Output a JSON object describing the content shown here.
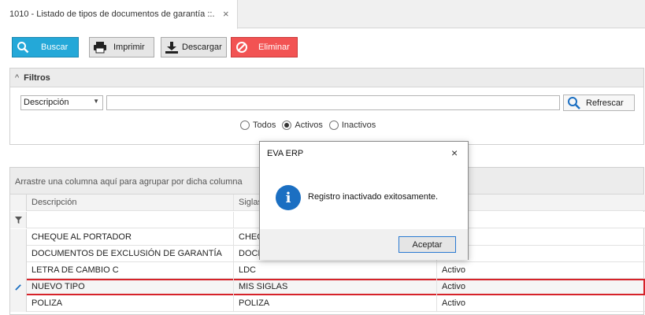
{
  "tab": {
    "title": "1010 - Listado de tipos de documentos de garantía ::.",
    "close": "×"
  },
  "toolbar": {
    "buscar": "Buscar",
    "imprimir": "Imprimir",
    "descargar": "Descargar",
    "eliminar": "Eliminar"
  },
  "filters": {
    "header": "Filtros",
    "field_select": "Descripción",
    "search_value": "",
    "refresh": "Refrescar",
    "radio_options": [
      "Todos",
      "Activos",
      "Inactivos"
    ],
    "radio_selected": "Activos"
  },
  "grid": {
    "group_hint": "Arrastre una columna aquí para agrupar por dicha columna",
    "columns": [
      "Descripción",
      "Siglas",
      ""
    ],
    "rows": [
      {
        "descripcion": "CHEQUE AL PORTADOR",
        "siglas": "CHEQ",
        "estado": ""
      },
      {
        "descripcion": "DOCUMENTOS DE EXCLUSIÓN DE GARANTÍA",
        "siglas": "DOCE",
        "estado": ""
      },
      {
        "descripcion": "LETRA DE CAMBIO C",
        "siglas": "LDC",
        "estado": "Activo"
      },
      {
        "descripcion": "NUEVO TIPO",
        "siglas": "MIS SIGLAS",
        "estado": "Activo"
      },
      {
        "descripcion": "POLIZA",
        "siglas": "POLIZA",
        "estado": "Activo"
      }
    ]
  },
  "dialog": {
    "title": "EVA ERP",
    "close": "×",
    "message": "Registro inactivado exitosamente.",
    "ok": "Aceptar"
  },
  "colors": {
    "buscar": "#24a8d8",
    "eliminar": "#f25353",
    "highlight": "#d6232a",
    "info": "#1b6fc2"
  }
}
